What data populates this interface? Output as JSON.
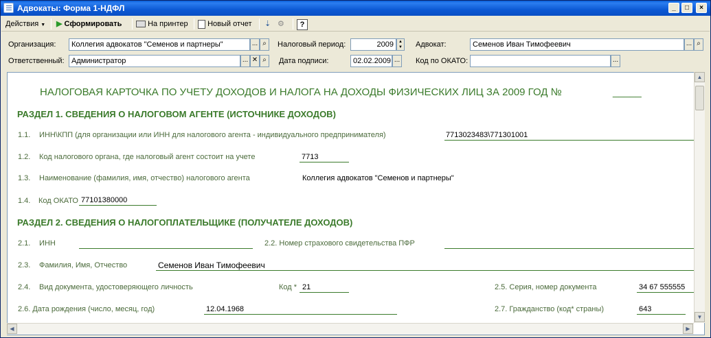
{
  "window": {
    "title": "Адвокаты: Форма 1-НДФЛ"
  },
  "toolbar": {
    "actions": "Действия",
    "generate": "Сформировать",
    "print": "На принтер",
    "new_report": "Новый отчет",
    "help": "?"
  },
  "fields": {
    "org_label": "Организация:",
    "org_value": "Коллегия адвокатов \"Семенов и партнеры\"",
    "period_label": "Налоговый период:",
    "period_value": "2009",
    "lawyer_label": "Адвокат:",
    "lawyer_value": "Семенов Иван Тимофеевич",
    "resp_label": "Ответственный:",
    "resp_value": "Администратор",
    "sign_label": "Дата подписи:",
    "sign_value": "02.02.2009",
    "okato_label": "Код по ОКАТО:",
    "okato_value": ""
  },
  "report": {
    "title": "НАЛОГОВАЯ КАРТОЧКА ПО УЧЕТУ ДОХОДОВ И НАЛОГА НА ДОХОДЫ ФИЗИЧЕСКИХ ЛИЦ ЗА 2009 ГОД №",
    "title_blank": "_____",
    "section1": "РАЗДЕЛ 1. СВЕДЕНИЯ О НАЛОГОВОМ АГЕНТЕ (ИСТОЧНИКЕ ДОХОДОВ)",
    "s1_1_num": "1.1.",
    "s1_1_label": "ИНН\\КПП (для организации или ИНН для налогового агента -  индивидуального предпринимателя)",
    "s1_1_value": "7713023483\\771301001",
    "s1_2_num": "1.2.",
    "s1_2_label": "Код налогового органа, где налоговый агент состоит на учете",
    "s1_2_value": "7713",
    "s1_3_num": "1.3.",
    "s1_3_label": "Наименование (фамилия, имя, отчество) налогового агента",
    "s1_3_value": "Коллегия адвокатов \"Семенов и партнеры\"",
    "s1_4_num": "1.4.",
    "s1_4_label": "Код ОКАТО",
    "s1_4_value": "77101380000",
    "section2": "РАЗДЕЛ 2. СВЕДЕНИЯ О НАЛОГОПЛАТЕЛЬЩИКЕ (ПОЛУЧАТЕЛЕ ДОХОДОВ)",
    "s2_1_num": "2.1.",
    "s2_1_label": "ИНН",
    "s2_2_label": "2.2. Номер страхового свидетельства ПФР",
    "s2_3_num": "2.3.",
    "s2_3_label": "Фамилия, Имя, Отчество",
    "s2_3_value": "Семенов Иван Тимофеевич",
    "s2_4_num": "2.4.",
    "s2_4_label": "Вид документа, удостоверяющего личность",
    "s2_4_code_label": "Код *",
    "s2_4_code_value": "21",
    "s2_5_label": "2.5. Серия, номер документа",
    "s2_5_value": "34 67 555555",
    "s2_6_label": "2.6. Дата рождения (число, месяц, год)",
    "s2_6_value": "12.04.1968",
    "s2_7_label": "2.7. Гражданство (код* страны)",
    "s2_7_value": "643"
  }
}
